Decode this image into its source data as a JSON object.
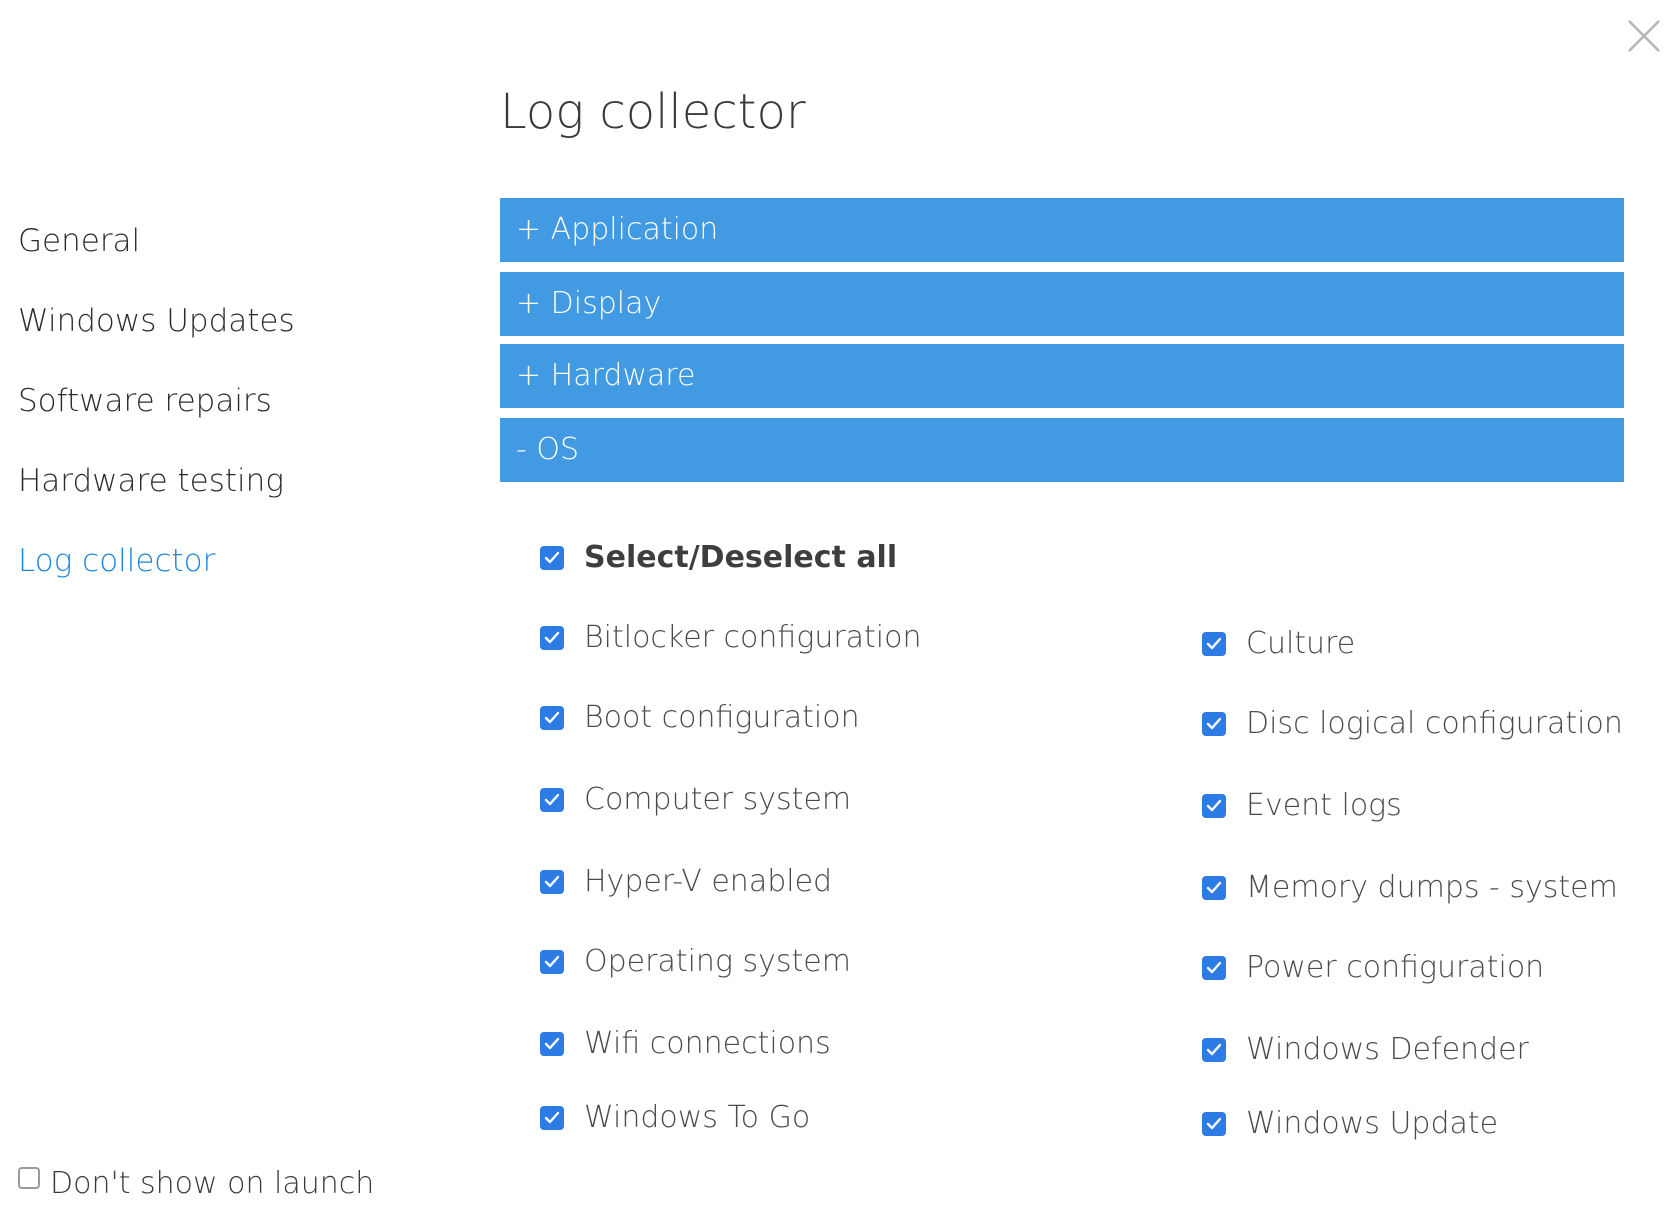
{
  "close": {
    "icon": "close-icon"
  },
  "sidebar": {
    "items": [
      {
        "label": "General"
      },
      {
        "label": "Windows Updates"
      },
      {
        "label": "Software repairs"
      },
      {
        "label": "Hardware testing"
      },
      {
        "label": "Log collector",
        "active": true
      }
    ],
    "dont_show_label": "Don't show on launch",
    "dont_show_checked": false
  },
  "main": {
    "title": "Log collector",
    "sections": [
      {
        "label": "+ Application",
        "expanded": false
      },
      {
        "label": "+ Display",
        "expanded": false
      },
      {
        "label": "+ Hardware",
        "expanded": false
      },
      {
        "label": "- OS",
        "expanded": true
      }
    ],
    "select_all_label": "Select/Deselect all",
    "left_options": [
      {
        "label": "Bitlocker configuration",
        "checked": true
      },
      {
        "label": "Boot configuration",
        "checked": true
      },
      {
        "label": "Computer system",
        "checked": true
      },
      {
        "label": "Hyper-V enabled",
        "checked": true
      },
      {
        "label": "Operating system",
        "checked": true
      },
      {
        "label": "Wifi connections",
        "checked": true
      },
      {
        "label": "Windows To Go",
        "checked": true
      }
    ],
    "right_options": [
      {
        "label": "Culture",
        "checked": true
      },
      {
        "label": "Disc logical configuration",
        "checked": true
      },
      {
        "label": "Event logs",
        "checked": true
      },
      {
        "label": "Memory dumps - system",
        "checked": true
      },
      {
        "label": "Power configuration",
        "checked": true
      },
      {
        "label": "Windows Defender",
        "checked": true
      },
      {
        "label": "Windows Update",
        "checked": true
      }
    ]
  },
  "colors": {
    "accent": "#419ae2",
    "active_link": "#1c86dc",
    "checkbox": "#2d7be5"
  }
}
